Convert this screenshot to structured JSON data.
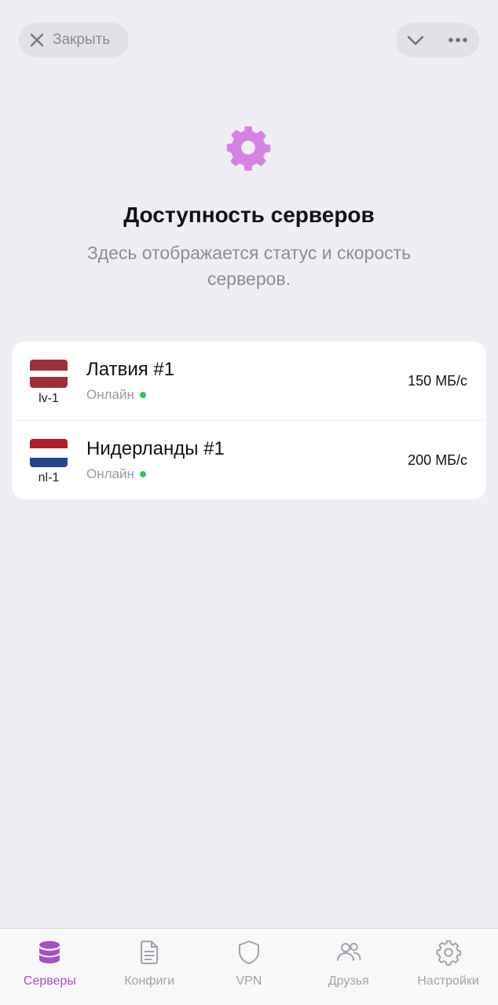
{
  "top_bar": {
    "close_label": "Закрыть",
    "close_icon": "x-icon",
    "collapse_icon": "chevron-down-icon",
    "more_icon": "ellipsis-icon"
  },
  "header": {
    "icon": "gear-icon",
    "icon_color": "#d583e3",
    "title": "Доступность серверов",
    "subtitle": "Здесь отображается статус и скорость серверов."
  },
  "servers": [
    {
      "code": "lv-1",
      "name": "Латвия #1",
      "status": "Онлайн",
      "status_color": "#35c35a",
      "speed": "150 МБ/с",
      "flag": [
        "#9e3039",
        "#ffffff",
        "#9e3039"
      ]
    },
    {
      "code": "nl-1",
      "name": "Нидерланды #1",
      "status": "Онлайн",
      "status_color": "#35c35a",
      "speed": "200 МБ/с",
      "flag": [
        "#ae1c28",
        "#ffffff",
        "#21468b"
      ]
    }
  ],
  "tabs": [
    {
      "label": "Серверы",
      "icon": "database-icon",
      "active": true
    },
    {
      "label": "Конфиги",
      "icon": "document-icon",
      "active": false
    },
    {
      "label": "VPN",
      "icon": "shield-icon",
      "active": false
    },
    {
      "label": "Друзья",
      "icon": "people-icon",
      "active": false
    },
    {
      "label": "Настройки",
      "icon": "gear-icon",
      "active": false
    }
  ],
  "colors": {
    "accent": "#a64fc6",
    "inactive": "#a3a2a8",
    "background": "#efeef4"
  }
}
